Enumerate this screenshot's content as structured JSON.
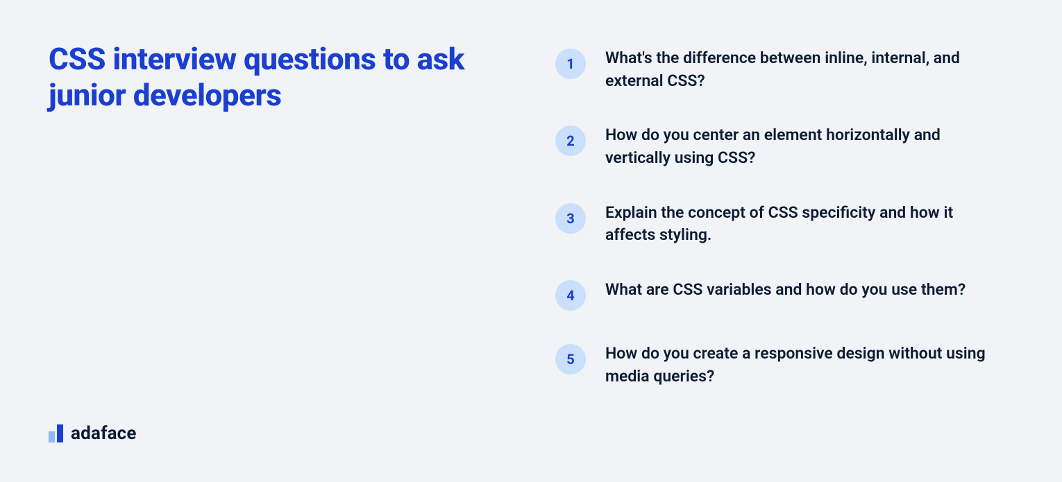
{
  "title": "CSS interview questions to ask junior developers",
  "brand": {
    "name": "adaface"
  },
  "colors": {
    "background": "#f2f3f6",
    "heading": "#1a3fd1",
    "text": "#0b1b34",
    "badge_bg": "#c9dffb",
    "badge_text": "#1a3fd1",
    "logo_light": "#8fb9f5",
    "logo_dark": "#1a3fd1"
  },
  "questions": [
    {
      "n": "1",
      "text": "What's the difference between inline, internal, and external CSS?"
    },
    {
      "n": "2",
      "text": "How do you center an element horizontally and vertically using CSS?"
    },
    {
      "n": "3",
      "text": "Explain the concept of CSS specificity and how it affects styling."
    },
    {
      "n": "4",
      "text": "What are CSS variables and how do you use them?"
    },
    {
      "n": "5",
      "text": "How do you create a responsive design without using media queries?"
    }
  ]
}
